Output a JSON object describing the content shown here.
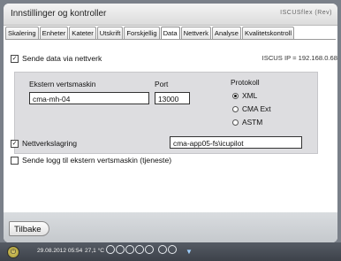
{
  "window": {
    "title": "Innstillinger og kontroller",
    "brand": "ISCUSflex (Rev)"
  },
  "tabs": [
    {
      "label": "Skalering"
    },
    {
      "label": "Enheter"
    },
    {
      "label": "Kateter"
    },
    {
      "label": "Utskrift"
    },
    {
      "label": "Forskjellig"
    },
    {
      "label": "Data",
      "active": true
    },
    {
      "label": "Nettverk"
    },
    {
      "label": "Analyse"
    },
    {
      "label": "Kvalitetskontroll"
    }
  ],
  "send_data": {
    "checkbox_label": "Sende data via nettverk",
    "checked": true,
    "ip_info": "ISCUS IP = 192.168.0.68"
  },
  "panel": {
    "host_label": "Ekstern vertsmaskin",
    "host_value": "cma-mh-04",
    "port_label": "Port",
    "port_value": "13000",
    "protocol_label": "Protokoll",
    "protocols": [
      {
        "label": "XML",
        "selected": true
      },
      {
        "label": "CMA Ext",
        "selected": false
      },
      {
        "label": "ASTM",
        "selected": false
      }
    ]
  },
  "network_storage": {
    "checkbox_label": "Nettverkslagring",
    "checked": true,
    "path_value": "cma-app05-fs\\icupilot"
  },
  "send_log": {
    "checkbox_label": "Sende logg til ekstern vertsmaskin (tjeneste)",
    "checked": false
  },
  "bottom": {
    "back_label": "Tilbake"
  },
  "status": {
    "datetime": "29.08.2012 05:54",
    "temperature": "27,1 °C",
    "slot_count": 8
  },
  "colors": {
    "frame": "#7a8089",
    "statusbar": "#44494f",
    "panel": "#dddde0"
  }
}
